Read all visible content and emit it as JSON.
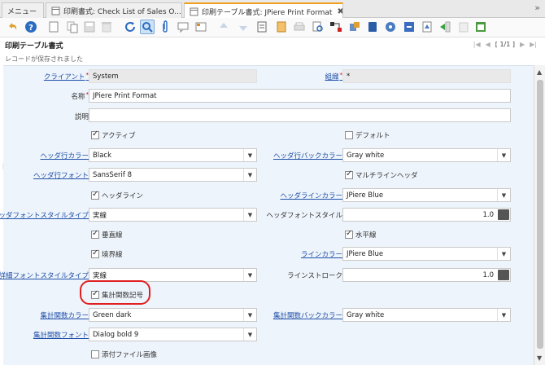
{
  "tabs": [
    {
      "label": "メニュー"
    },
    {
      "label": "印刷書式: Check List of Sales O...",
      "close": "✖"
    },
    {
      "label": "印刷テーブル書式: JPiere Print Format",
      "close": "✖"
    }
  ],
  "toolbar": {
    "buttons": [
      "undo-icon",
      "help-icon",
      "new-icon",
      "copy-icon",
      "save-icon",
      "delete-icon",
      "refresh-icon",
      "find-icon",
      "attachment-icon",
      "chat-icon",
      "grid-toggle-icon",
      "previous-icon",
      "next-icon",
      "report-icon",
      "archive-icon",
      "print-icon",
      "zoom-across-icon",
      "workflow-icon",
      "request-icon",
      "product-info-icon",
      "archived-icon",
      "process-icon",
      "translate-icon",
      "export-icon",
      "import-icon",
      "customize-icon"
    ]
  },
  "window": {
    "title": "印刷テーブル書式",
    "record_count": "[ 1/1 ]",
    "status": "レコードが保存されました"
  },
  "form": {
    "client_label": "クライアント",
    "client_value": "System",
    "org_label": "組織",
    "org_value": "*",
    "name_label": "名称",
    "name_value": "JPiere Print Format",
    "description_label": "説明",
    "description_value": "",
    "active_label": "アクティブ",
    "default_label": "デフォルト",
    "header_row_color_label": "ヘッダ行カラー",
    "header_row_color_value": "Black",
    "header_row_bg_color_label": "ヘッダ行バックカラー",
    "header_row_bg_color_value": "Gray white",
    "header_row_font_label": "ヘッダ行フォント",
    "header_row_font_value": "SansSerif 8",
    "multiline_header_label": "マルチラインヘッダ",
    "header_line_label": "ヘッダライン",
    "header_line_color_label": "ヘッダラインカラー",
    "header_line_color_value": "JPiere Blue",
    "header_font_style_type_label": "ヘッダフォントスタイルタイプ",
    "header_font_style_type_value": "実線",
    "header_font_style_label": "ヘッダフォントスタイル",
    "header_font_style_value": "1.0",
    "vertical_line_label": "垂直線",
    "horizontal_line_label": "水平線",
    "border_label": "境界線",
    "line_color_label": "ラインカラー",
    "line_color_value": "JPiere Blue",
    "detail_font_style_type_label": "詳細フォントスタイルタイプ",
    "detail_font_style_type_value": "実線",
    "line_stroke_label": "ラインストローク",
    "line_stroke_value": "1.0",
    "function_symbol_label": "集計関数記号",
    "function_color_label": "集計関数カラー",
    "function_color_value": "Green dark",
    "function_bg_color_label": "集計関数バックカラー",
    "function_bg_color_value": "Gray white",
    "function_font_label": "集計関数フォント",
    "function_font_value": "Dialog bold 9",
    "attachment_image_label": "添付ファイル画像"
  },
  "checkboxes": {
    "active": true,
    "default": false,
    "multiline_header": true,
    "header_line": true,
    "vertical_line": true,
    "horizontal_line": true,
    "border": true,
    "function_symbol": true,
    "attachment_image": false
  },
  "colors": {
    "active_tab_accent": "#f0a020",
    "form_bg": "#eef4fb",
    "link": "#1f4fa8",
    "highlight": "#e02020"
  }
}
